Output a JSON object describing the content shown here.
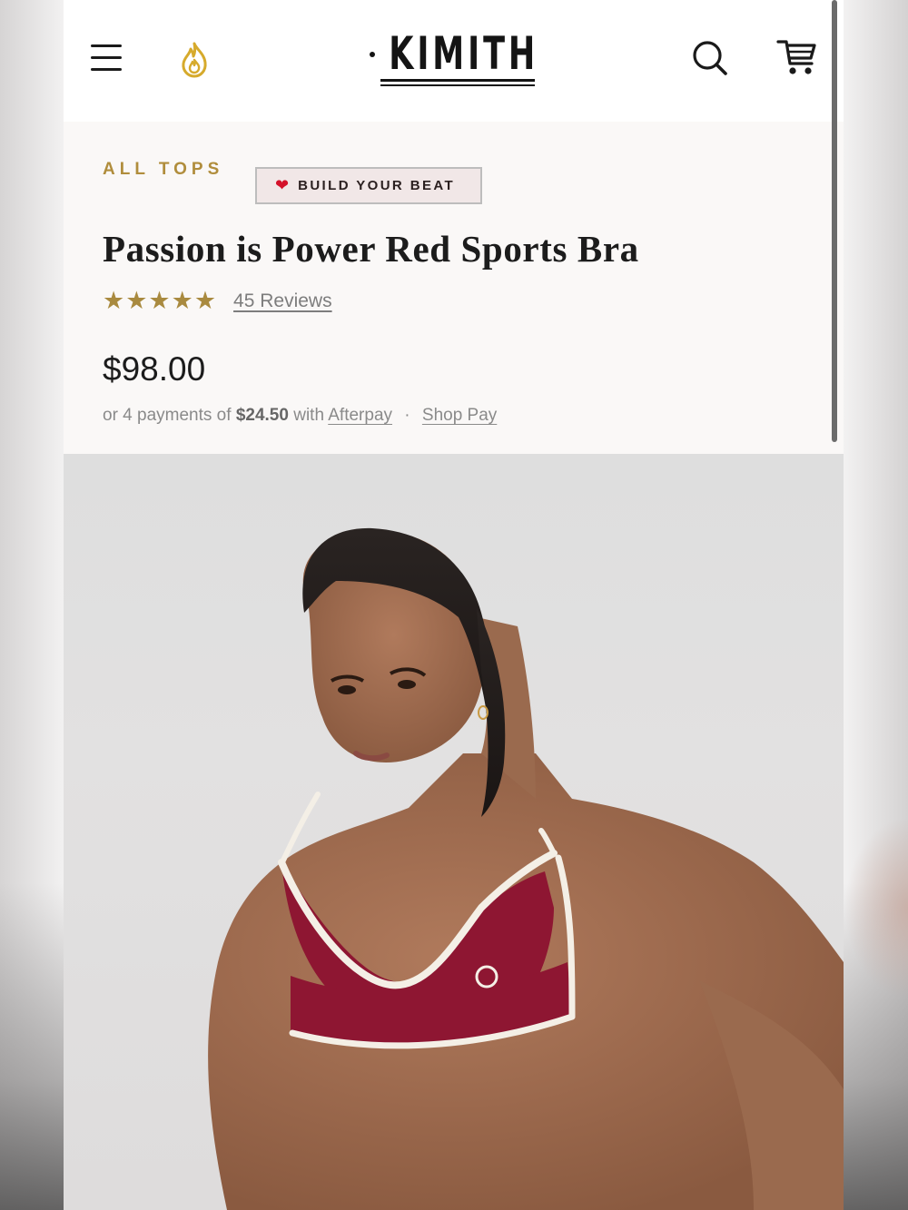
{
  "header": {
    "brand": "KIMITH",
    "menu_icon": "hamburger-menu-icon",
    "flame_icon": "flame-icon",
    "search_icon": "search-icon",
    "cart_icon": "cart-icon"
  },
  "product": {
    "breadcrumb": "ALL TOPS",
    "badge_label": "BUILD YOUR BEAT",
    "badge_icon": "heart-icon",
    "title": "Passion is Power Red Sports Bra",
    "rating_stars": 5,
    "reviews_label": "45 Reviews",
    "price": "$98.00",
    "installments": {
      "prefix": "or 4 payments of",
      "amount": "$24.50",
      "middle": "with",
      "afterpay": "Afterpay",
      "separator": "·",
      "shop_pay": "Shop Pay"
    }
  },
  "colors": {
    "accent_gold": "#b08d3c",
    "star_gold": "#a98a3f",
    "product_red": "#8e1632",
    "text_dark": "#1c1c1c"
  }
}
